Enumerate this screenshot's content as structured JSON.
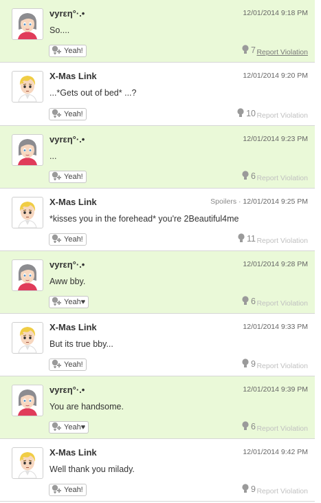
{
  "posts": [
    {
      "user": "vyrεη°·.•",
      "avatar": "gray-hair-girl",
      "time": "12/01/2014 9:18 PM",
      "spoiler": "",
      "text": "So....",
      "yeah": "Yeah!",
      "count": "7",
      "report": "Report Violation",
      "highlight": true
    },
    {
      "user": "X-Mas Link",
      "avatar": "blond-boy",
      "time": "12/01/2014 9:20 PM",
      "spoiler": "",
      "text": "...*Gets out of bed* ...?",
      "yeah": "Yeah!",
      "count": "10",
      "report": "Report Violation",
      "highlight": false
    },
    {
      "user": "vyrεη°·.•",
      "avatar": "gray-hair-girl",
      "time": "12/01/2014 9:23 PM",
      "spoiler": "",
      "text": "...",
      "yeah": "Yeah!",
      "count": "6",
      "report": "Report Violation",
      "highlight": true
    },
    {
      "user": "X-Mas Link",
      "avatar": "blond-boy",
      "time": "12/01/2014 9:25 PM",
      "spoiler": "Spoilers · ",
      "text": "*kisses you in the forehead* you're 2Beautiful4me",
      "yeah": "Yeah!",
      "count": "11",
      "report": "Report Violation",
      "highlight": false
    },
    {
      "user": "vyrεη°·.•",
      "avatar": "gray-hair-girl",
      "time": "12/01/2014 9:28 PM",
      "spoiler": "",
      "text": "Aww bby.",
      "yeah": "Yeah♥",
      "count": "6",
      "report": "Report Violation",
      "highlight": true
    },
    {
      "user": "X-Mas Link",
      "avatar": "blond-boy",
      "time": "12/01/2014 9:33 PM",
      "spoiler": "",
      "text": "But its true bby...",
      "yeah": "Yeah!",
      "count": "9",
      "report": "Report Violation",
      "highlight": false
    },
    {
      "user": "vyrεη°·.•",
      "avatar": "gray-hair-girl",
      "time": "12/01/2014 9:39 PM",
      "spoiler": "",
      "text": "You are handsome.",
      "yeah": "Yeah♥",
      "count": "6",
      "report": "Report Violation",
      "highlight": true
    },
    {
      "user": "X-Mas Link",
      "avatar": "blond-boy",
      "time": "12/01/2014 9:42 PM",
      "spoiler": "",
      "text": "Well thank you milady.",
      "yeah": "Yeah!",
      "count": "9",
      "report": "Report Violation",
      "highlight": false
    }
  ],
  "colors": {
    "highlight_bg": "#eaf9d8",
    "border": "#d6d6d6",
    "muted": "#888888"
  }
}
